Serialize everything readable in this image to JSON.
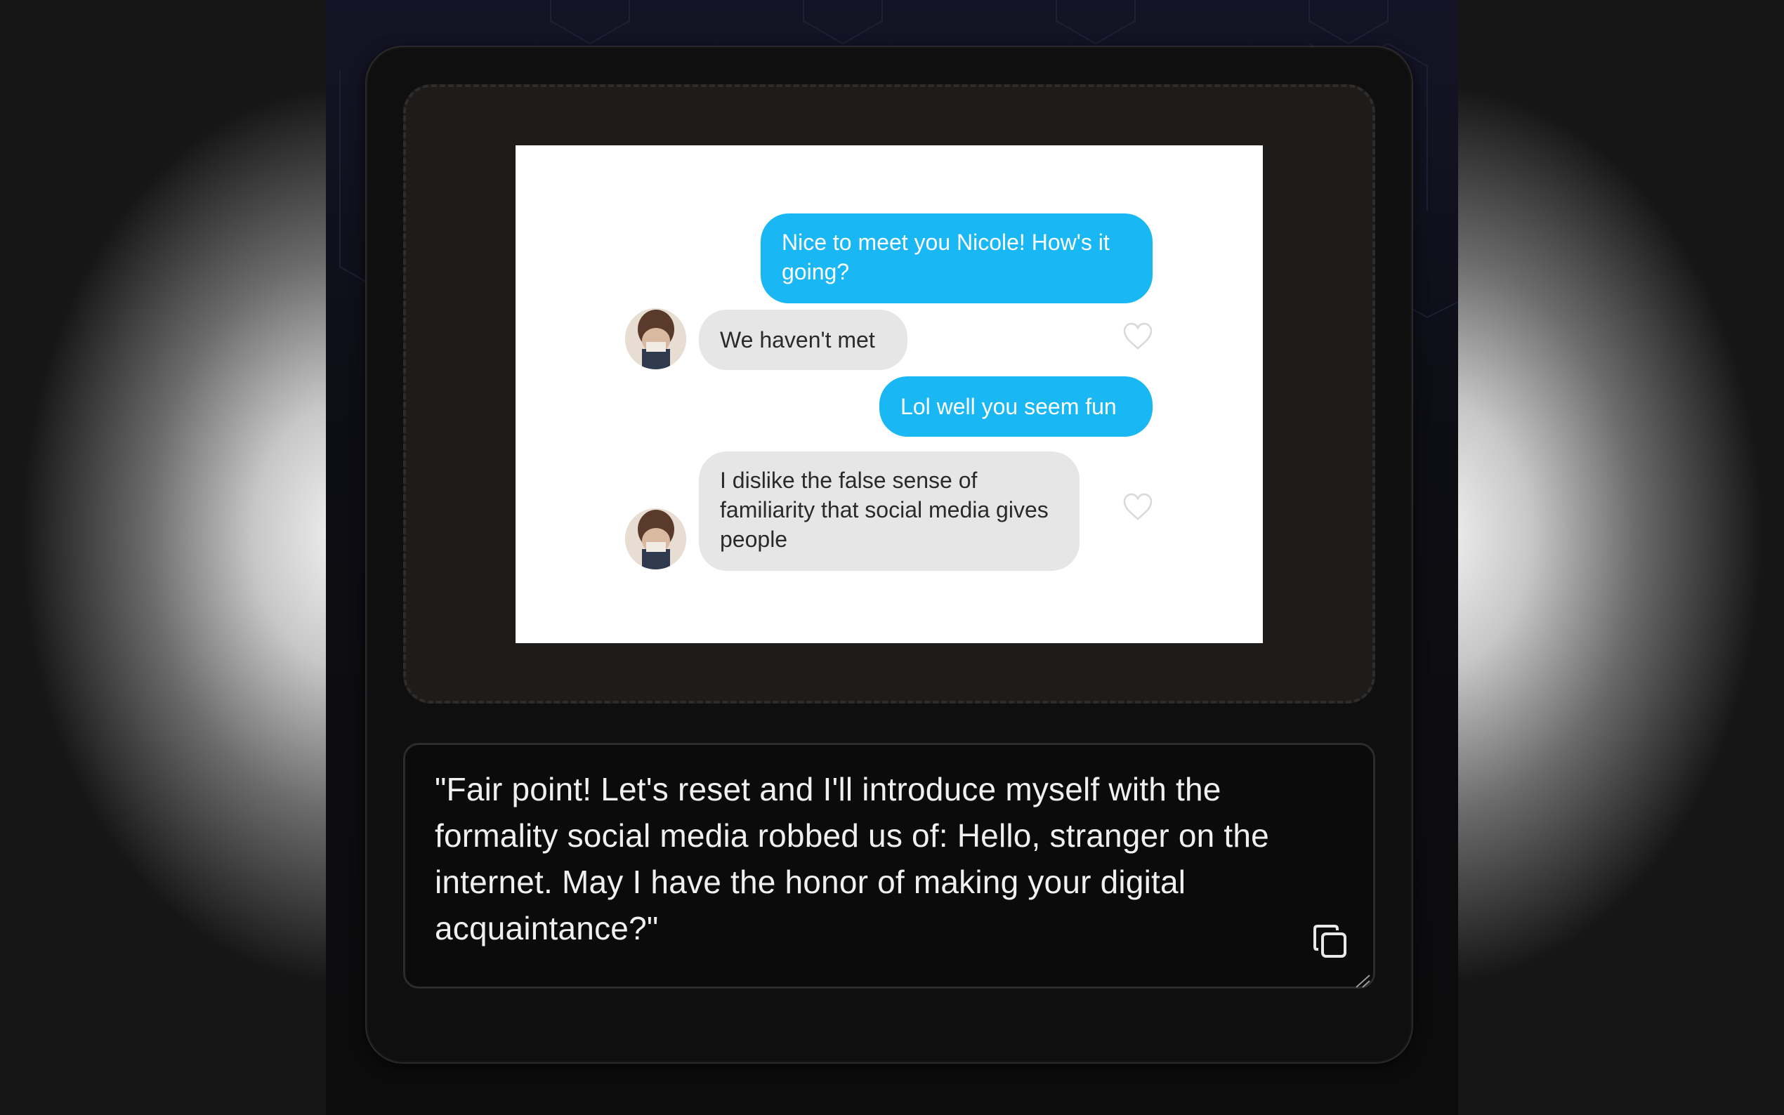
{
  "chat": {
    "messages": [
      {
        "from": "me",
        "text": "Nice to meet you Nicole! How's it going?"
      },
      {
        "from": "them",
        "text": "We haven't met"
      },
      {
        "from": "me",
        "text": "Lol well you seem fun"
      },
      {
        "from": "them",
        "text": "I dislike the false sense of familiarity that social media gives people"
      }
    ],
    "outgoing_color": "#1ab7f5",
    "incoming_color": "#e6e6e6"
  },
  "reply": {
    "text": "\"Fair point! Let's reset and I'll introduce myself with the formality social media robbed us of: Hello, stranger on the internet. May I have the honor of making your digital acquaintance?\""
  },
  "icons": {
    "copy": "copy-icon",
    "resize": "resize-handle-icon",
    "heart": "heart-icon"
  }
}
